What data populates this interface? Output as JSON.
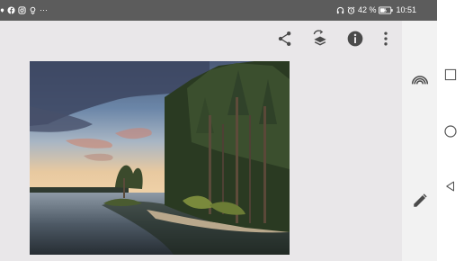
{
  "statusbar": {
    "left_icons": [
      "location-icon",
      "facebook-icon",
      "instagram-icon",
      "maps-pin-icon",
      "more-notifications-icon"
    ],
    "more_label": "···",
    "battery_percent": "42 %",
    "time": "10:51",
    "right_icons": [
      "headphones-icon",
      "alarm-icon",
      "battery-icon"
    ]
  },
  "toolbar": {
    "actions": [
      "share-icon",
      "edit-layers-icon",
      "info-icon",
      "more-options-icon"
    ]
  },
  "photo": {
    "description_icon": "landscape-photo",
    "colors": {
      "sky_top": "#4b5a78",
      "sky_bottom": "#e8c9a0",
      "cloud": "#3c4560",
      "trees": "#2a3a22",
      "water": "#3e4a54",
      "sand": "#b9a88c"
    }
  },
  "sidepanel": {
    "icons": [
      "rainbow-icon",
      "pencil-icon"
    ]
  },
  "navbar": {
    "icons": [
      "recent-apps-icon",
      "home-icon",
      "back-icon"
    ]
  },
  "colors": {
    "statusbar_bg": "#5c5c5c",
    "app_bg": "#e9e7e9",
    "icon_color": "#4a4a4a"
  }
}
